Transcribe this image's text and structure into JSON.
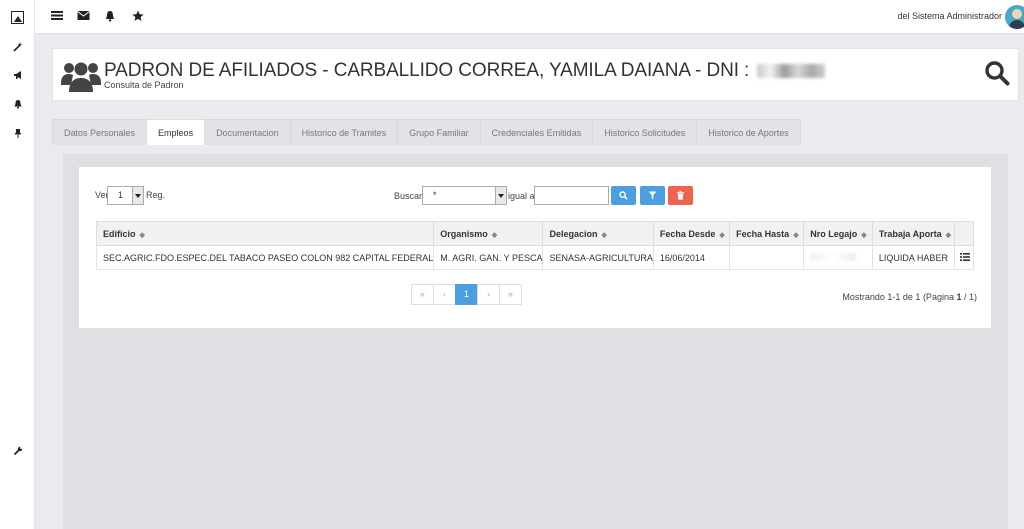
{
  "topbar": {
    "user_name": "del Sistema Administrador"
  },
  "header": {
    "title": "PADRON DE AFILIADOS - CARBALLIDO CORREA, YAMILA DAIANA - DNI : ",
    "subtitle": "Consulta de Padron"
  },
  "tabs": [
    {
      "label": "Datos Personales",
      "active": false
    },
    {
      "label": "Empleos",
      "active": true
    },
    {
      "label": "Documentacion",
      "active": false
    },
    {
      "label": "Historico de Tramites",
      "active": false
    },
    {
      "label": "Grupo Familiar",
      "active": false
    },
    {
      "label": "Credenciales Emitidas",
      "active": false
    },
    {
      "label": "Historico Solicitudes",
      "active": false
    },
    {
      "label": "Historico de Aportes",
      "active": false
    }
  ],
  "controls": {
    "ver_label": "Ver",
    "ver_value": "1",
    "reg_label": "Reg.",
    "buscar_label": "Buscar",
    "buscar_value": "*",
    "igual_label": "igual a",
    "igual_value": ""
  },
  "table": {
    "headers": [
      "Edificio",
      "Organismo",
      "Delegacion",
      "Fecha Desde",
      "Fecha Hasta",
      "Nro Legajo",
      "Trabaja Aporta",
      ""
    ],
    "rows": [
      {
        "edificio": "SEC.AGRIC.FDO.ESPEC.DEL TABACO PASEO COLON 982 CAPITAL FEDERAL",
        "organismo": "M. AGRI. GAN. Y PESCA",
        "delegacion": "SENASA-AGRICULTURA",
        "fecha_desde": "16/06/2014",
        "fecha_hasta": "",
        "nro_legajo": "",
        "trabaja_aporta": "LIQUIDA HABER"
      }
    ]
  },
  "pager": {
    "first": "«",
    "prev": "‹",
    "current": "1",
    "next": "›",
    "last": "»",
    "showing_prefix": "Mostrando 1-1 de 1 (Pagina ",
    "showing_page": "1",
    "showing_suffix": " / 1)"
  },
  "colors": {
    "search_button": "#4d9ee0",
    "filter_button": "#4d9ee0",
    "delete_button": "#f0634e",
    "active_page": "#4d9ee0"
  }
}
